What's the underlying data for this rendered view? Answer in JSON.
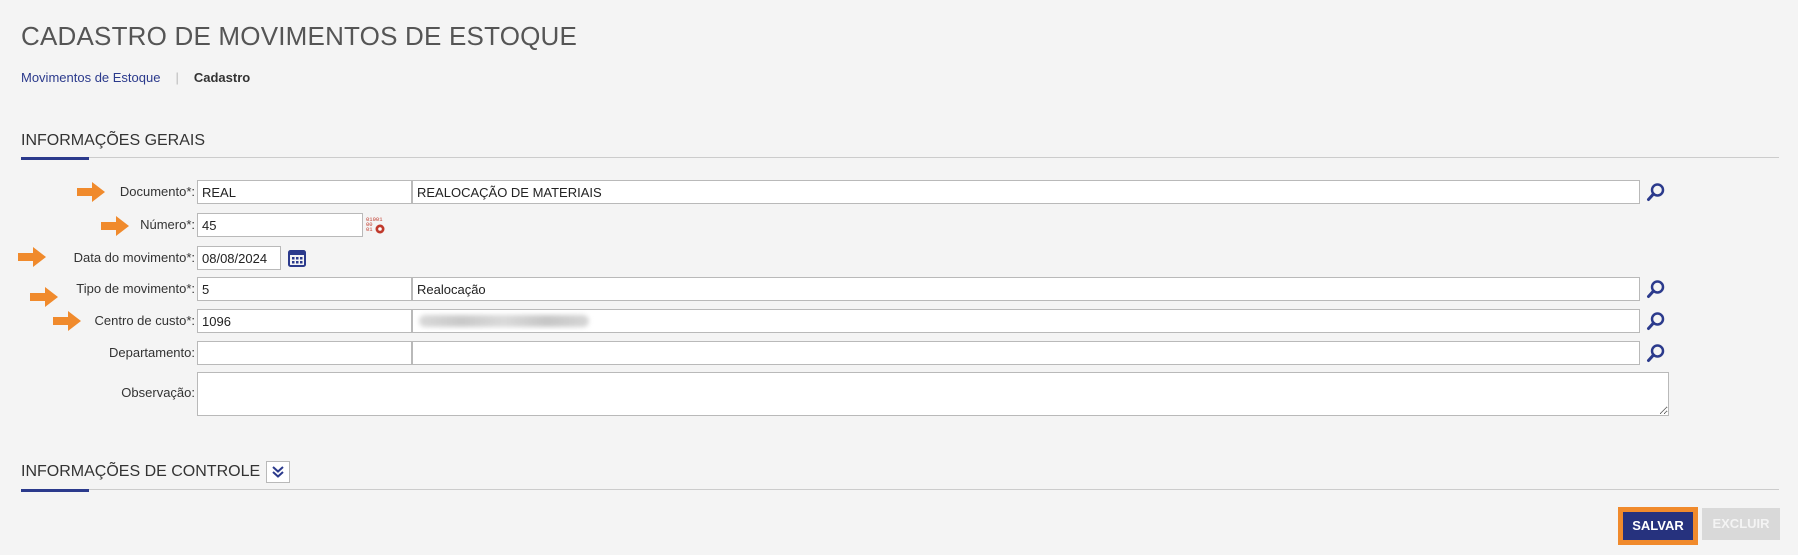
{
  "page": {
    "title": "CADASTRO DE MOVIMENTOS DE ESTOQUE"
  },
  "breadcrumb": {
    "link": "Movimentos de Estoque",
    "current": "Cadastro"
  },
  "sections": {
    "general": "INFORMAÇÕES GERAIS",
    "control": "INFORMAÇÕES DE CONTROLE"
  },
  "form": {
    "documento": {
      "label": "Documento*:",
      "code": "REAL",
      "description": "REALOCAÇÃO DE MATERIAIS"
    },
    "numero": {
      "label": "Número*:",
      "value": "45"
    },
    "data": {
      "label": "Data do movimento*:",
      "value": "08/08/2024"
    },
    "tipo": {
      "label": "Tipo de movimento*:",
      "code": "5",
      "description": "Realocação"
    },
    "centro": {
      "label": "Centro de custo*:",
      "code": "1096",
      "description": ""
    },
    "departamento": {
      "label": "Departamento:",
      "code": "",
      "description": ""
    },
    "observacao": {
      "label": "Observação:",
      "value": ""
    }
  },
  "buttons": {
    "save": "SALVAR",
    "delete": "EXCLUIR"
  },
  "colors": {
    "accent": "#2b3a8c",
    "highlight": "#f08a2c",
    "disabled": "#d9d9d9"
  },
  "icons": {
    "lookup": "search-icon",
    "generate_number": "number-generator-icon",
    "calendar": "calendar-icon",
    "collapse": "double-chevron-down-icon",
    "arrow": "arrow-right-icon"
  }
}
